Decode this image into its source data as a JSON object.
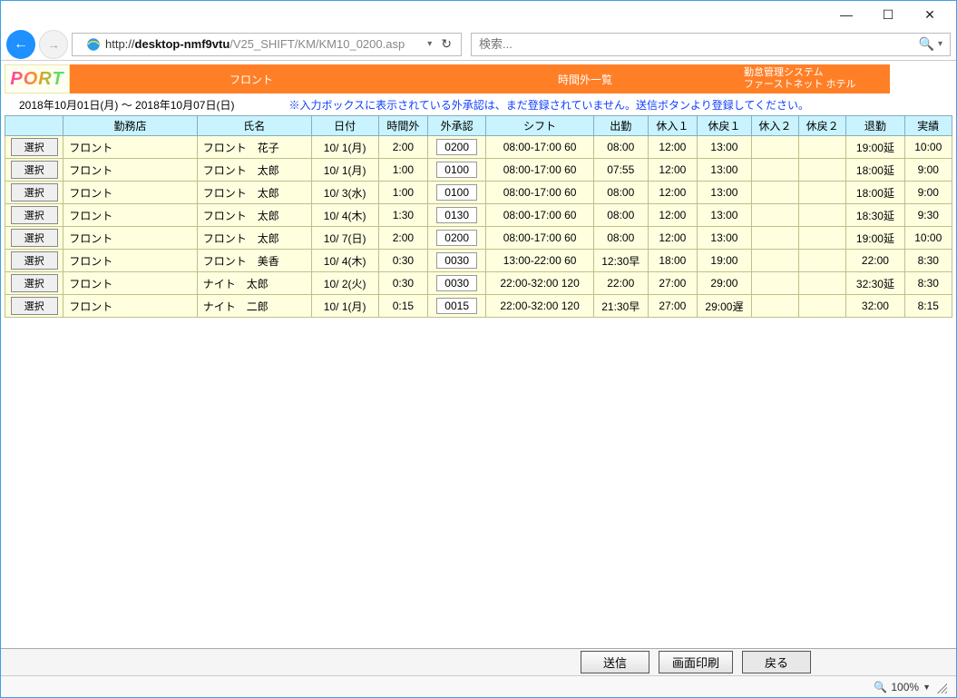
{
  "window": {
    "minimize": "—",
    "maximize": "☐",
    "close": "✕"
  },
  "browser": {
    "url_prefix": "http://",
    "url_host": "desktop-nmf9vtu",
    "url_path": "/V25_SHIFT/KM/KM10_0200.asp",
    "search_placeholder": "検索..."
  },
  "header": {
    "logo": "PORT",
    "area_left": "フロント",
    "area_mid": "時間外一覧",
    "area_right1": "勤怠管理システム",
    "area_right2": "ファーストネット ホテル"
  },
  "subhead": {
    "daterange": "2018年10月01日(月) ～ 2018年10月07日(日)",
    "notice": "※入力ボックスに表示されている外承認は、まだ登録されていません。送信ボタンより登録してください。"
  },
  "columns": [
    "",
    "勤務店",
    "氏名",
    "日付",
    "時間外",
    "外承認",
    "シフト",
    "出勤",
    "休入１",
    "休戻１",
    "休入２",
    "休戻２",
    "退勤",
    "実績"
  ],
  "select_label": "選択",
  "rows": [
    {
      "store": "フロント",
      "name": "フロント　花子",
      "date": "10/ 1(月)",
      "ot": "2:00",
      "appr": "0200",
      "shift": "08:00-17:00 60",
      "in": "08:00",
      "b1i": "12:00",
      "b1o": "13:00",
      "b2i": "",
      "b2o": "",
      "out": "19:00延",
      "act": "10:00"
    },
    {
      "store": "フロント",
      "name": "フロント　太郎",
      "date": "10/ 1(月)",
      "ot": "1:00",
      "appr": "0100",
      "shift": "08:00-17:00 60",
      "in": "07:55",
      "b1i": "12:00",
      "b1o": "13:00",
      "b2i": "",
      "b2o": "",
      "out": "18:00延",
      "act": "9:00"
    },
    {
      "store": "フロント",
      "name": "フロント　太郎",
      "date": "10/ 3(水)",
      "ot": "1:00",
      "appr": "0100",
      "shift": "08:00-17:00 60",
      "in": "08:00",
      "b1i": "12:00",
      "b1o": "13:00",
      "b2i": "",
      "b2o": "",
      "out": "18:00延",
      "act": "9:00"
    },
    {
      "store": "フロント",
      "name": "フロント　太郎",
      "date": "10/ 4(木)",
      "ot": "1:30",
      "appr": "0130",
      "shift": "08:00-17:00 60",
      "in": "08:00",
      "b1i": "12:00",
      "b1o": "13:00",
      "b2i": "",
      "b2o": "",
      "out": "18:30延",
      "act": "9:30"
    },
    {
      "store": "フロント",
      "name": "フロント　太郎",
      "date": "10/ 7(日)",
      "ot": "2:00",
      "appr": "0200",
      "shift": "08:00-17:00 60",
      "in": "08:00",
      "b1i": "12:00",
      "b1o": "13:00",
      "b2i": "",
      "b2o": "",
      "out": "19:00延",
      "act": "10:00"
    },
    {
      "store": "フロント",
      "name": "フロント　美香",
      "date": "10/ 4(木)",
      "ot": "0:30",
      "appr": "0030",
      "shift": "13:00-22:00 60",
      "in": "12:30早",
      "b1i": "18:00",
      "b1o": "19:00",
      "b2i": "",
      "b2o": "",
      "out": "22:00",
      "act": "8:30"
    },
    {
      "store": "フロント",
      "name": "ナイト　太郎",
      "date": "10/ 2(火)",
      "ot": "0:30",
      "appr": "0030",
      "shift": "22:00-32:00 120",
      "in": "22:00",
      "b1i": "27:00",
      "b1o": "29:00",
      "b2i": "",
      "b2o": "",
      "out": "32:30延",
      "act": "8:30"
    },
    {
      "store": "フロント",
      "name": "ナイト　二郎",
      "date": "10/ 1(月)",
      "ot": "0:15",
      "appr": "0015",
      "shift": "22:00-32:00 120",
      "in": "21:30早",
      "b1i": "27:00",
      "b1o": "29:00遅",
      "b1o_hl": true,
      "b2i": "",
      "b2o": "",
      "out": "32:00",
      "act": "8:15"
    }
  ],
  "footer": {
    "send": "送信",
    "print": "画面印刷",
    "back": "戻る"
  },
  "status": {
    "zoom": "100%"
  }
}
